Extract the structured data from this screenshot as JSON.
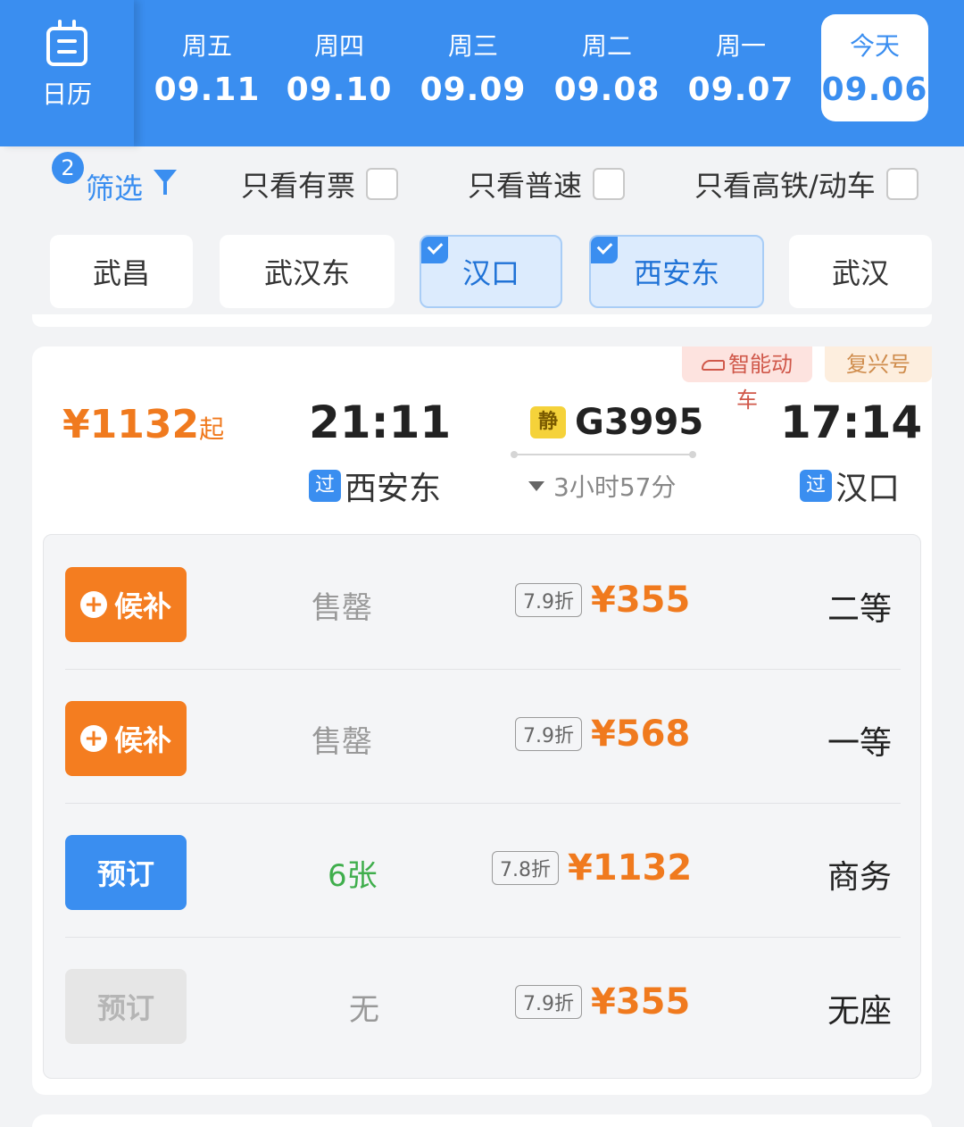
{
  "calendar": {
    "label": "日历",
    "icon": "calendar-icon"
  },
  "dates": [
    {
      "weekday": "周五",
      "date": "09.11"
    },
    {
      "weekday": "周四",
      "date": "09.10"
    },
    {
      "weekday": "周三",
      "date": "09.09"
    },
    {
      "weekday": "周二",
      "date": "09.08"
    },
    {
      "weekday": "周一",
      "date": "09.07"
    },
    {
      "weekday": "今天",
      "date": "09.06",
      "active": true
    }
  ],
  "filters": {
    "badge": "2",
    "filter_label": "筛选",
    "only_tickets": "只看有票",
    "only_normal": "只看普速",
    "only_highspeed": "只看高铁/动车"
  },
  "stations": [
    "武昌",
    "武汉东",
    "汉口",
    "西安东",
    "武汉"
  ],
  "train": {
    "tag_fuxing": "复兴号",
    "tag_smart": "智能动车",
    "depart_time": "17:14",
    "depart_station": "汉口",
    "depart_badge": "过",
    "arrive_time": "21:11",
    "arrive_station": "西安东",
    "arrive_badge": "过",
    "number": "G3995",
    "quiet_badge": "静",
    "duration": "3小时57分",
    "from_price": "¥1132",
    "from_suffix": "起"
  },
  "seats": [
    {
      "type": "二等",
      "price": "¥355",
      "discount": "7.9折",
      "stock": "售罄",
      "action": "候补"
    },
    {
      "type": "一等",
      "price": "¥568",
      "discount": "7.9折",
      "stock": "售罄",
      "action": "候补"
    },
    {
      "type": "商务",
      "price": "¥1132",
      "discount": "7.8折",
      "stock": "6张",
      "action": "预订"
    },
    {
      "type": "无座",
      "price": "¥355",
      "discount": "7.9折",
      "stock": "无",
      "action": "预订"
    }
  ],
  "colors": {
    "accent": "#3a8ef0",
    "price": "#f07a1e",
    "available": "#3fae4c"
  }
}
